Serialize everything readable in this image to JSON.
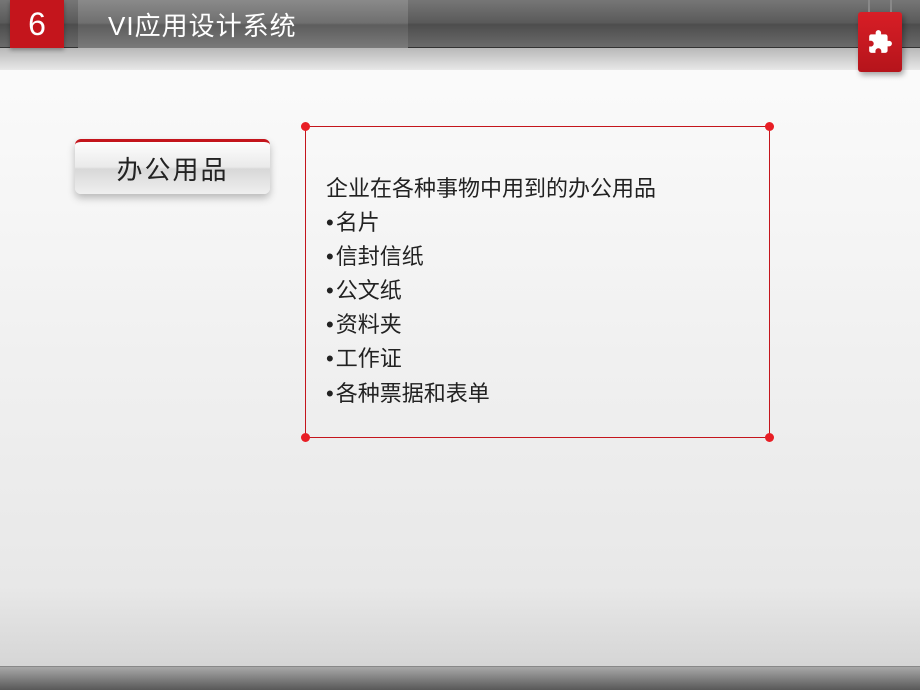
{
  "header": {
    "number": "6",
    "title": "VI应用设计系统"
  },
  "label_badge": "办公用品",
  "content": {
    "intro": "企业在各种事物中用到的办公用品",
    "items": [
      "名片",
      "信封信纸",
      "公文纸",
      "资料夹",
      "工作证",
      "各种票据和表单"
    ]
  },
  "icon": "puzzle-piece-icon",
  "colors": {
    "accent": "#c4151c",
    "header_gray": "#6a6a6a"
  }
}
